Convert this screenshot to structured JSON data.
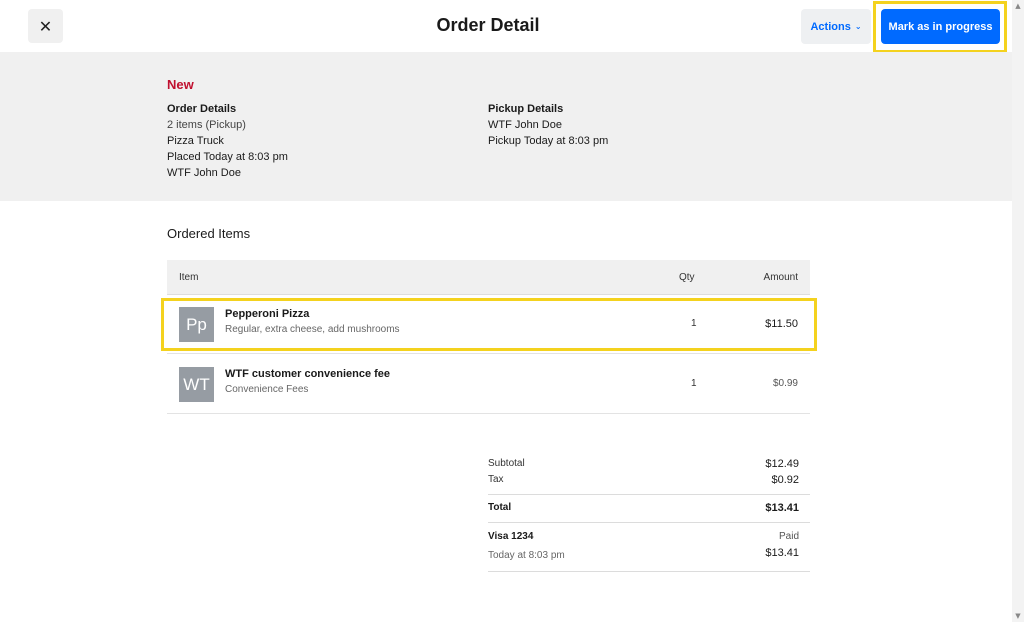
{
  "header": {
    "close_icon": "close-icon",
    "close_glyph": "✕",
    "title": "Order Detail",
    "actions_label": "Actions",
    "primary_label": "Mark as in progress"
  },
  "summary": {
    "status": "New",
    "order_details": {
      "heading": "Order Details",
      "items_count": "2 items (Pickup)",
      "location": "Pizza Truck",
      "placed": "Placed Today at 8:03 pm",
      "customer": "WTF John Doe"
    },
    "pickup_details": {
      "heading": "Pickup Details",
      "name": "WTF John Doe",
      "time": "Pickup Today at 8:03 pm"
    }
  },
  "items": {
    "section_title": "Ordered Items",
    "columns": {
      "item": "Item",
      "qty": "Qty",
      "amount": "Amount"
    },
    "rows": [
      {
        "initials": "Pp",
        "name": "Pepperoni Pizza",
        "desc": "Regular, extra cheese, add mushrooms",
        "qty": "1",
        "amount": "$11.50"
      },
      {
        "initials": "WT",
        "name": "WTF customer convenience fee",
        "desc": "Convenience Fees",
        "qty": "1",
        "amount": "$0.99"
      }
    ]
  },
  "totals": {
    "subtotal_label": "Subtotal",
    "subtotal": "$12.49",
    "tax_label": "Tax",
    "tax": "$0.92",
    "total_label": "Total",
    "total": "$13.41",
    "payment_label": "Visa 1234",
    "payment_status": "Paid",
    "payment_time": "Today at 8:03 pm",
    "payment_amount": "$13.41"
  },
  "colors": {
    "accent": "#006aff",
    "status_new": "#c0102f",
    "highlight": "#f4d21e"
  }
}
